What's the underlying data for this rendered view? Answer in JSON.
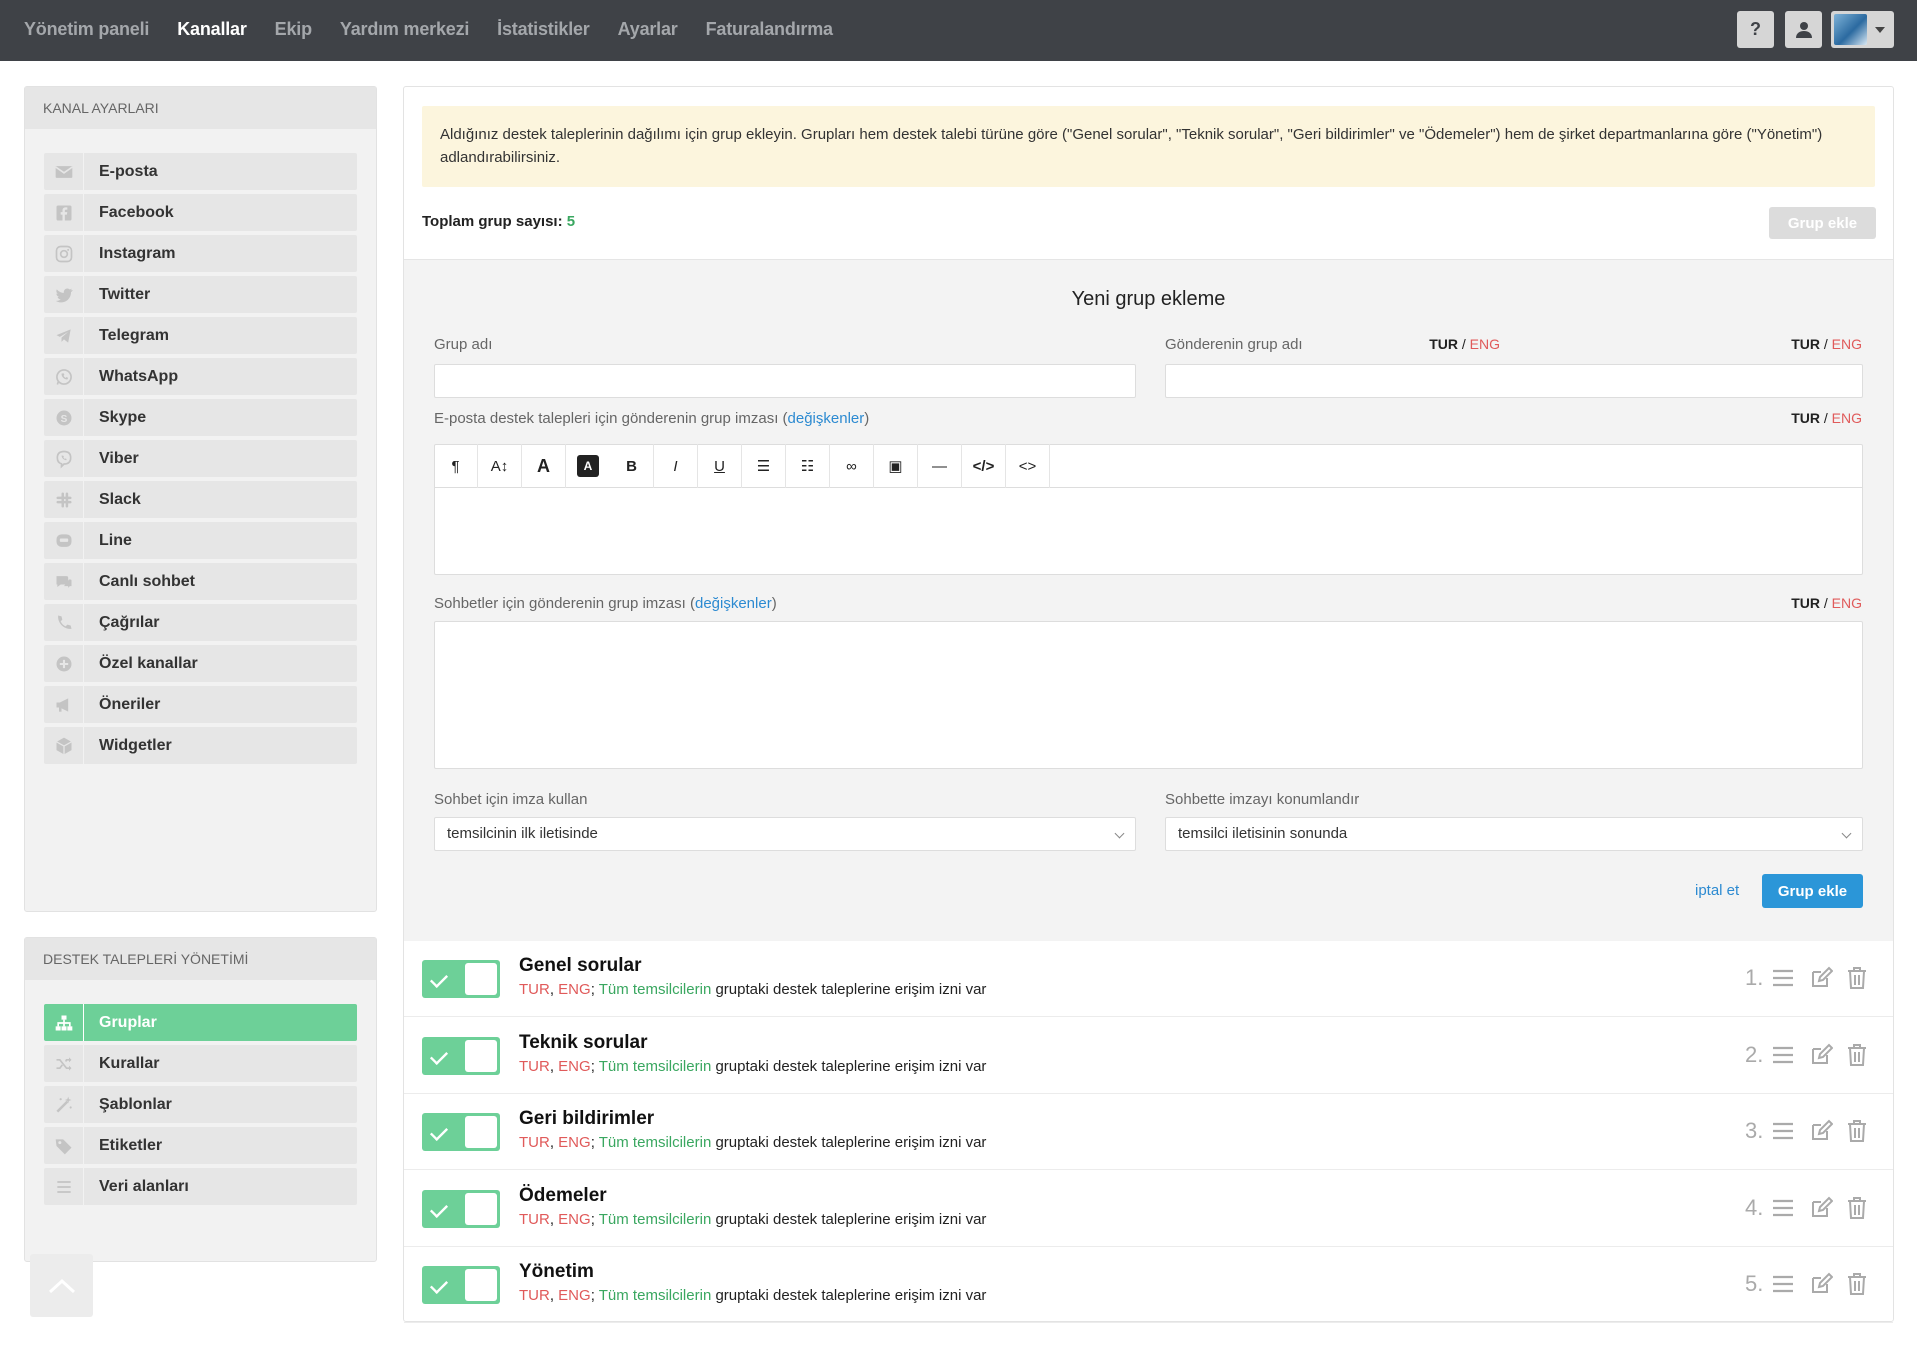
{
  "nav": {
    "items": [
      "Yönetim paneli",
      "Kanallar",
      "Ekip",
      "Yardım merkezi",
      "İstatistikler",
      "Ayarlar",
      "Faturalandırma"
    ],
    "active_index": 1,
    "help_icon": "question-icon",
    "user_icon": "user-icon"
  },
  "sidebar": {
    "channels_title": "KANAL AYARLARI",
    "channels": [
      {
        "label": "E-posta",
        "icon": "envelope-icon"
      },
      {
        "label": "Facebook",
        "icon": "facebook-icon"
      },
      {
        "label": "Instagram",
        "icon": "instagram-icon"
      },
      {
        "label": "Twitter",
        "icon": "twitter-icon"
      },
      {
        "label": "Telegram",
        "icon": "telegram-icon"
      },
      {
        "label": "WhatsApp",
        "icon": "whatsapp-icon"
      },
      {
        "label": "Skype",
        "icon": "skype-icon"
      },
      {
        "label": "Viber",
        "icon": "viber-icon"
      },
      {
        "label": "Slack",
        "icon": "slack-icon"
      },
      {
        "label": "Line",
        "icon": "line-icon"
      },
      {
        "label": "Canlı sohbet",
        "icon": "chat-icon"
      },
      {
        "label": "Çağrılar",
        "icon": "phone-icon"
      },
      {
        "label": "Özel kanallar",
        "icon": "plus-circle-icon"
      },
      {
        "label": "Öneriler",
        "icon": "megaphone-icon"
      },
      {
        "label": "Widgetler",
        "icon": "cube-icon"
      }
    ],
    "tickets_title": "DESTEK TALEPLERİ YÖNETİMİ",
    "tickets": [
      {
        "label": "Gruplar",
        "icon": "sitemap-icon",
        "active": true
      },
      {
        "label": "Kurallar",
        "icon": "shuffle-icon"
      },
      {
        "label": "Şablonlar",
        "icon": "magic-wand-icon"
      },
      {
        "label": "Etiketler",
        "icon": "tags-icon"
      },
      {
        "label": "Veri alanları",
        "icon": "list-icon"
      }
    ]
  },
  "main": {
    "notice": "Aldığınız destek taleplerinin dağılımı için grup ekleyin. Grupları hem destek talebi türüne göre (\"Genel sorular\", \"Teknik sorular\", \"Geri bildirimler\" ve \"Ödemeler\") hem de şirket departmanlarına göre (\"Yönetim\") adlandırabilirsiniz.",
    "total_label": "Toplam grup sayısı:",
    "total_value": "5",
    "add_group_disabled": "Grup ekle"
  },
  "form": {
    "title": "Yeni grup ekleme",
    "group_name_label": "Grup adı",
    "sender_group_name_label": "Gönderenin grup adı",
    "email_signature_label": "E-posta destek talepleri için gönderenin grup imzası (",
    "chat_signature_label": "Sohbetler için gönderenin grup imzası (",
    "variables_link": "değişkenler",
    "close_paren": ")",
    "lang_tur": "TUR",
    "lang_sep": " / ",
    "lang_eng": "ENG",
    "use_signature_label": "Sohbet için imza kullan",
    "use_signature_value": "temsilcinin ilk iletisinde",
    "position_signature_label": "Sohbette imzayı konumlandır",
    "position_signature_value": "temsilci iletisinin sonunda",
    "cancel": "iptal et",
    "submit": "Grup ekle",
    "toolbar": [
      {
        "glyph": "¶",
        "name": "paragraph-icon"
      },
      {
        "glyph": "A↕",
        "name": "font-size-icon"
      },
      {
        "glyph": "A",
        "name": "font-color-icon"
      },
      {
        "glyph": "A",
        "name": "highlight-icon"
      },
      {
        "glyph": "B",
        "name": "bold-icon"
      },
      {
        "glyph": "I",
        "name": "italic-icon"
      },
      {
        "glyph": "U",
        "name": "underline-icon"
      },
      {
        "glyph": "☰",
        "name": "bullet-list-icon"
      },
      {
        "glyph": "☷",
        "name": "ordered-list-icon"
      },
      {
        "glyph": "∞",
        "name": "link-icon"
      },
      {
        "glyph": "▣",
        "name": "image-icon"
      },
      {
        "glyph": "—",
        "name": "horizontal-rule-icon"
      },
      {
        "glyph": "</>",
        "name": "code-view-icon"
      },
      {
        "glyph": "<>",
        "name": "code-icon"
      }
    ]
  },
  "groups": [
    {
      "name": "Genel sorular",
      "num": "1.",
      "enabled": true
    },
    {
      "name": "Teknik sorular",
      "num": "2.",
      "enabled": true
    },
    {
      "name": "Geri bildirimler",
      "num": "3.",
      "enabled": true
    },
    {
      "name": "Ödemeler",
      "num": "4.",
      "enabled": true
    },
    {
      "name": "Yönetim",
      "num": "5.",
      "enabled": true
    }
  ],
  "group_desc": {
    "tur": "TUR",
    "comma": ", ",
    "eng": "ENG",
    "semi": "; ",
    "agents": "Tüm temsilcilerin",
    "rest": " gruptaki destek taleplerine erişim izni var"
  },
  "colors": {
    "accent_green": "#6dd098",
    "accent_blue": "#2b96d8",
    "lang_red": "#e05a5a",
    "nav_bg": "#3f4247"
  }
}
